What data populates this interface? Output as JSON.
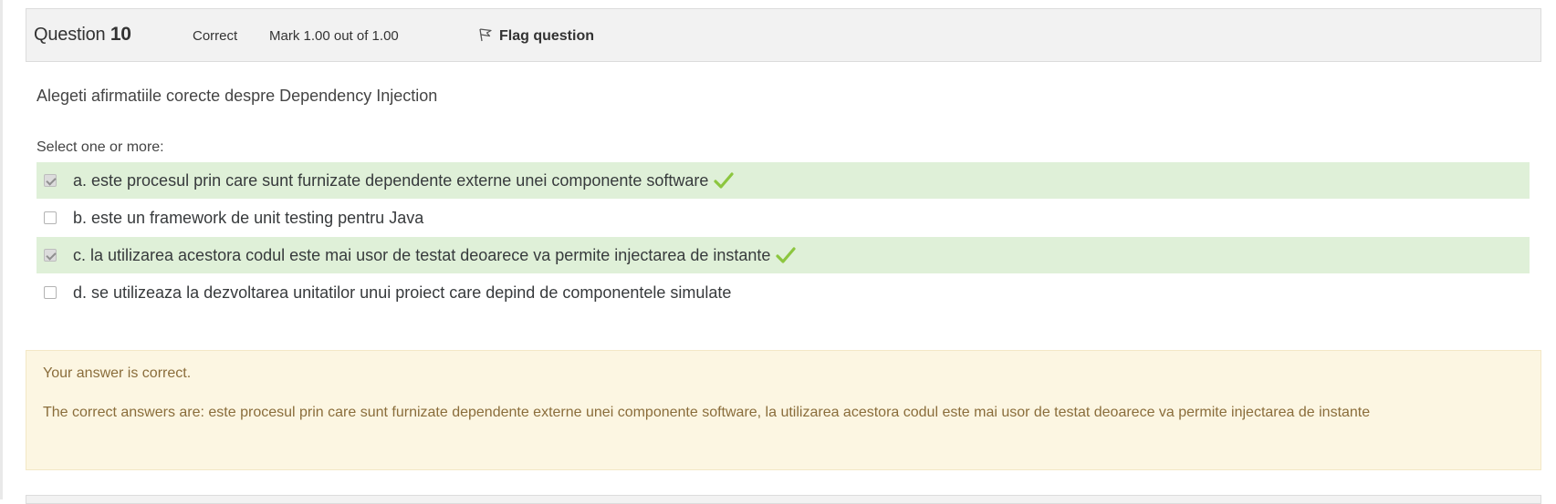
{
  "question": {
    "label": "Question",
    "number": "10",
    "state": "Correct",
    "grade": "Mark 1.00 out of 1.00",
    "flag_label": "Flag question",
    "text": "Alegeti afirmatiile corecte despre Dependency Injection",
    "prompt": "Select one or more:"
  },
  "answers": [
    {
      "text": "a. este procesul prin care sunt furnizate dependente externe unei componente software",
      "checked": true,
      "correct": true
    },
    {
      "text": "b. este un framework de unit testing pentru Java",
      "checked": false,
      "correct": false
    },
    {
      "text": "c. la utilizarea acestora codul este mai usor de testat deoarece va permite injectarea de instante",
      "checked": true,
      "correct": true
    },
    {
      "text": "d. se utilizeaza la dezvoltarea unitatilor unui proiect care depind de componentele simulate",
      "checked": false,
      "correct": false
    }
  ],
  "feedback": {
    "status": "Your answer is correct.",
    "right_answer": "The correct answers are: este procesul prin care sunt furnizate dependente externe unei componente software, la utilizarea acestora codul este mai usor de testat deoarece va permite injectarea de instante"
  },
  "colors": {
    "correct_bg": "#dff0d8",
    "tick": "#8cc63f",
    "feedback_bg": "#fcf6e2",
    "feedback_text": "#8a6d3b"
  },
  "icons": {
    "flag": "flag-icon",
    "tick": "check-icon"
  }
}
